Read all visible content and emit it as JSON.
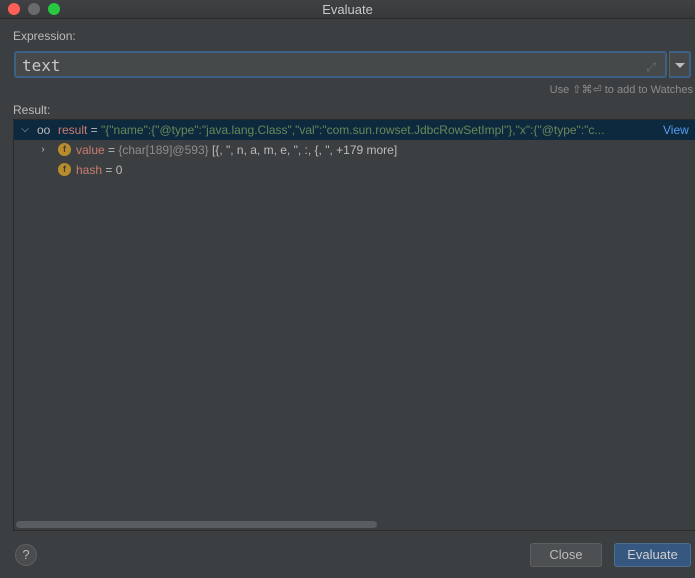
{
  "window": {
    "title": "Evaluate"
  },
  "expression": {
    "label": "Expression:",
    "value": "text",
    "hint": "Use ⇧⌘⏎ to add to Watches"
  },
  "result": {
    "label": "Result:",
    "rows": [
      {
        "name": "result",
        "eq": " = ",
        "value": "\"{\"name\":{\"@type\":\"java.lang.Class\",\"val\":\"com.sun.rowset.JdbcRowSetImpl\"},\"x\":{\"@type\":\"c...",
        "link": "View"
      },
      {
        "name": "value",
        "eq": " = ",
        "type": "{char[189]@593}",
        "value": " [{, \", n, a, m, e, \", :, {, \", +179 more]"
      },
      {
        "name": "hash",
        "eq": " = ",
        "value": "0"
      }
    ]
  },
  "footer": {
    "help": "?",
    "close": "Close",
    "evaluate": "Evaluate"
  },
  "colors": {
    "background": "#3c3f41",
    "selection": "#0d293e",
    "accent": "#365880",
    "string": "#6a8759",
    "var": "#cc7b70",
    "field_icon": "#b88b2c"
  }
}
